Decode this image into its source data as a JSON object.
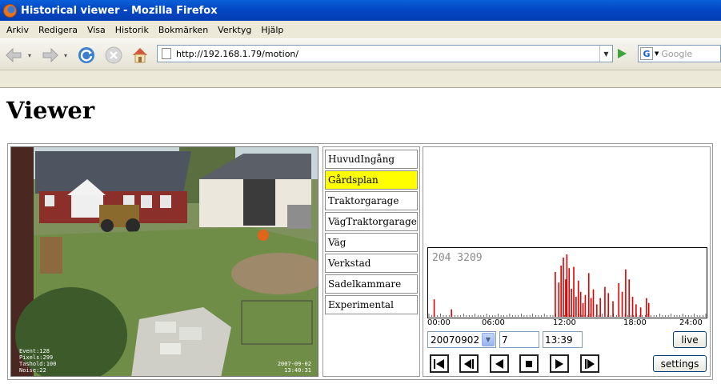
{
  "window": {
    "title": "Historical viewer - Mozilla Firefox"
  },
  "menu": {
    "items": [
      "Arkiv",
      "Redigera",
      "Visa",
      "Historik",
      "Bokmärken",
      "Verktyg",
      "Hjälp"
    ]
  },
  "toolbar": {
    "url": "http://192.168.1.79/motion/",
    "search_placeholder": "Google",
    "search_engine_letter": "G",
    "icons": [
      "back-arrow-icon",
      "forward-arrow-icon",
      "reload-icon",
      "stop-icon",
      "home-icon",
      "page-icon",
      "go-icon"
    ]
  },
  "page": {
    "heading": "Viewer",
    "camera_overlay": {
      "stats": [
        "Event:128",
        "Pixels:299",
        "Tashold:100",
        "Noise:22"
      ],
      "timestamp_date": "2007-09-02",
      "timestamp_time": "13:40:31"
    },
    "cameras": [
      {
        "label": "HuvudIngång",
        "selected": false
      },
      {
        "label": "Gårdsplan",
        "selected": true
      },
      {
        "label": "Traktorgarage",
        "selected": false
      },
      {
        "label": "VägTraktorgarage",
        "selected": false
      },
      {
        "label": "Väg",
        "selected": false
      },
      {
        "label": "Verkstad",
        "selected": false
      },
      {
        "label": "Sadelkammare",
        "selected": false
      },
      {
        "label": "Experimental",
        "selected": false
      }
    ],
    "controls": {
      "date": "20070902",
      "hour": "7",
      "time": "13:39",
      "live_label": "live",
      "settings_label": "settings",
      "playback_icons": [
        "skip-to-start-icon",
        "step-back-icon",
        "play-reverse-icon",
        "stop-icon",
        "play-icon",
        "skip-to-end-icon"
      ]
    },
    "colors": {
      "highlight": "#ffff00",
      "bars": "#e00000",
      "count_text": "#8c8c8c"
    }
  },
  "chart_data": {
    "type": "bar",
    "title": "204 3209",
    "x_unit": "hours of day",
    "xlim": [
      0,
      24
    ],
    "x_ticks": [
      "00:00",
      "06:00",
      "12:00",
      "18:00",
      "24:00"
    ],
    "series": [
      {
        "values": [
          [
            0.4,
            28
          ],
          [
            1.9,
            12
          ],
          [
            10.9,
            72
          ],
          [
            11.2,
            55
          ],
          [
            11.4,
            82
          ],
          [
            11.6,
            95
          ],
          [
            11.8,
            60
          ],
          [
            11.9,
            100
          ],
          [
            12.1,
            78
          ],
          [
            12.3,
            45
          ],
          [
            12.5,
            80
          ],
          [
            12.7,
            32
          ],
          [
            12.9,
            58
          ],
          [
            13.1,
            40
          ],
          [
            13.3,
            22
          ],
          [
            13.5,
            35
          ],
          [
            13.8,
            70
          ],
          [
            14.0,
            30
          ],
          [
            14.2,
            44
          ],
          [
            14.5,
            20
          ],
          [
            14.8,
            30
          ],
          [
            15.2,
            48
          ],
          [
            15.5,
            38
          ],
          [
            15.9,
            25
          ],
          [
            16.4,
            54
          ],
          [
            16.7,
            40
          ],
          [
            17.0,
            76
          ],
          [
            17.3,
            60
          ],
          [
            17.6,
            32
          ],
          [
            17.9,
            20
          ],
          [
            18.3,
            15
          ],
          [
            18.8,
            30
          ],
          [
            19.0,
            22
          ]
        ]
      }
    ]
  }
}
